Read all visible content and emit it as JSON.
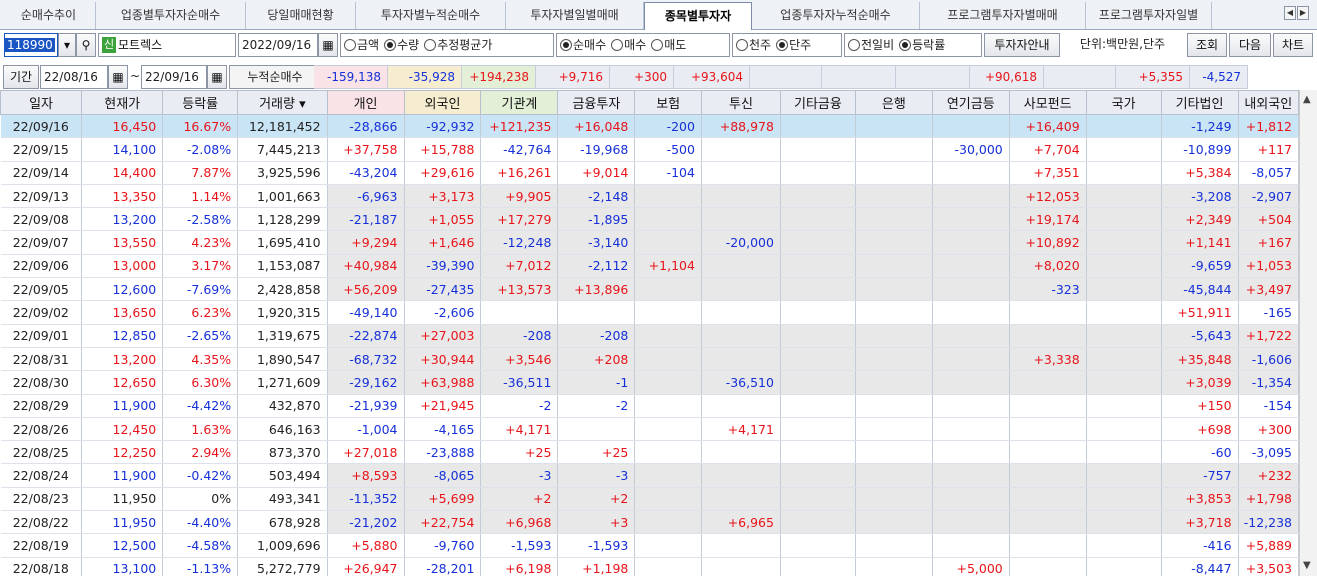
{
  "tabs": [
    {
      "label": "순매수추이"
    },
    {
      "label": "업종별투자자순매수"
    },
    {
      "label": "당일매매현황"
    },
    {
      "label": "투자자별누적순매수"
    },
    {
      "label": "투자자별일별매매"
    },
    {
      "label": "종목별투자자"
    },
    {
      "label": "업종투자자누적순매수"
    },
    {
      "label": "프로그램투자자별매매"
    },
    {
      "label": "프로그램투자자일별"
    }
  ],
  "active_tab": "종목별투자자",
  "toolbar": {
    "code": "118990",
    "name_badge": "신",
    "name": "모트렉스",
    "date": "2022/09/16",
    "group1": [
      "금액",
      "수량",
      "추정평균가"
    ],
    "group1_selected": "수량",
    "group2": [
      "순매수",
      "매수",
      "매도"
    ],
    "group2_selected": "순매수",
    "group3": [
      "천주",
      "단주"
    ],
    "group3_selected": "단주",
    "group4": [
      "전일비",
      "등락률"
    ],
    "group4_selected": "등락률",
    "investor_info_btn": "투자자안내",
    "unit": "단위:백만원,단주",
    "query_btn": "조회",
    "next_btn": "다음",
    "chart_btn": "차트"
  },
  "period": {
    "label": "기간",
    "from": "22/08/16",
    "sep": "~",
    "to": "22/09/16",
    "cum_label": "누적순매수"
  },
  "summary": [
    "-159,138",
    "-35,928",
    "+194,238",
    "+9,716",
    "+300",
    "+93,604",
    "",
    "",
    "",
    "+90,618",
    "",
    "+5,355",
    "-4,527"
  ],
  "columns": [
    "일자",
    "현재가",
    "등락률",
    "거래량",
    "개인",
    "외국인",
    "기관계",
    "금융투자",
    "보험",
    "투신",
    "기타금융",
    "은행",
    "연기금등",
    "사모펀드",
    "국가",
    "기타법인",
    "내외국인"
  ],
  "rows": [
    [
      "22/09/16",
      "16,450",
      "16.67%",
      "12,181,452",
      "-28,866",
      "-92,932",
      "+121,235",
      "+16,048",
      "-200",
      "+88,978",
      "",
      "",
      "",
      "+16,409",
      "",
      "-1,249",
      "+1,812"
    ],
    [
      "22/09/15",
      "14,100",
      "-2.08%",
      "7,445,213",
      "+37,758",
      "+15,788",
      "-42,764",
      "-19,968",
      "-500",
      "",
      "",
      "",
      "-30,000",
      "+7,704",
      "",
      "-10,899",
      "+117"
    ],
    [
      "22/09/14",
      "14,400",
      "7.87%",
      "3,925,596",
      "-43,204",
      "+29,616",
      "+16,261",
      "+9,014",
      "-104",
      "",
      "",
      "",
      "",
      "+7,351",
      "",
      "+5,384",
      "-8,057"
    ],
    [
      "22/09/13",
      "13,350",
      "1.14%",
      "1,001,663",
      "-6,963",
      "+3,173",
      "+9,905",
      "-2,148",
      "",
      "",
      "",
      "",
      "",
      "+12,053",
      "",
      "-3,208",
      "-2,907"
    ],
    [
      "22/09/08",
      "13,200",
      "-2.58%",
      "1,128,299",
      "-21,187",
      "+1,055",
      "+17,279",
      "-1,895",
      "",
      "",
      "",
      "",
      "",
      "+19,174",
      "",
      "+2,349",
      "+504"
    ],
    [
      "22/09/07",
      "13,550",
      "4.23%",
      "1,695,410",
      "+9,294",
      "+1,646",
      "-12,248",
      "-3,140",
      "",
      "-20,000",
      "",
      "",
      "",
      "+10,892",
      "",
      "+1,141",
      "+167"
    ],
    [
      "22/09/06",
      "13,000",
      "3.17%",
      "1,153,087",
      "+40,984",
      "-39,390",
      "+7,012",
      "-2,112",
      "+1,104",
      "",
      "",
      "",
      "",
      "+8,020",
      "",
      "-9,659",
      "+1,053"
    ],
    [
      "22/09/05",
      "12,600",
      "-7.69%",
      "2,428,858",
      "+56,209",
      "-27,435",
      "+13,573",
      "+13,896",
      "",
      "",
      "",
      "",
      "",
      "-323",
      "",
      "-45,844",
      "+3,497"
    ],
    [
      "22/09/02",
      "13,650",
      "6.23%",
      "1,920,315",
      "-49,140",
      "-2,606",
      "",
      "",
      "",
      "",
      "",
      "",
      "",
      "",
      "",
      "+51,911",
      "-165"
    ],
    [
      "22/09/01",
      "12,850",
      "-2.65%",
      "1,319,675",
      "-22,874",
      "+27,003",
      "-208",
      "-208",
      "",
      "",
      "",
      "",
      "",
      "",
      "",
      "-5,643",
      "+1,722"
    ],
    [
      "22/08/31",
      "13,200",
      "4.35%",
      "1,890,547",
      "-68,732",
      "+30,944",
      "+3,546",
      "+208",
      "",
      "",
      "",
      "",
      "",
      "+3,338",
      "",
      "+35,848",
      "-1,606"
    ],
    [
      "22/08/30",
      "12,650",
      "6.30%",
      "1,271,609",
      "-29,162",
      "+63,988",
      "-36,511",
      "-1",
      "",
      "-36,510",
      "",
      "",
      "",
      "",
      "",
      "+3,039",
      "-1,354"
    ],
    [
      "22/08/29",
      "11,900",
      "-4.42%",
      "432,870",
      "-21,939",
      "+21,945",
      "-2",
      "-2",
      "",
      "",
      "",
      "",
      "",
      "",
      "",
      "+150",
      "-154"
    ],
    [
      "22/08/26",
      "12,450",
      "1.63%",
      "646,163",
      "-1,004",
      "-4,165",
      "+4,171",
      "",
      "",
      "+4,171",
      "",
      "",
      "",
      "",
      "",
      "+698",
      "+300"
    ],
    [
      "22/08/25",
      "12,250",
      "2.94%",
      "873,370",
      "+27,018",
      "-23,888",
      "+25",
      "+25",
      "",
      "",
      "",
      "",
      "",
      "",
      "",
      "-60",
      "-3,095"
    ],
    [
      "22/08/24",
      "11,900",
      "-0.42%",
      "503,494",
      "+8,593",
      "-8,065",
      "-3",
      "-3",
      "",
      "",
      "",
      "",
      "",
      "",
      "",
      "-757",
      "+232"
    ],
    [
      "22/08/23",
      "11,950",
      "0%",
      "493,341",
      "-11,352",
      "+5,699",
      "+2",
      "+2",
      "",
      "",
      "",
      "",
      "",
      "",
      "",
      "+3,853",
      "+1,798"
    ],
    [
      "22/08/22",
      "11,950",
      "-4.40%",
      "678,928",
      "-21,202",
      "+22,754",
      "+6,968",
      "+3",
      "",
      "+6,965",
      "",
      "",
      "",
      "",
      "",
      "+3,718",
      "-12,238"
    ],
    [
      "22/08/19",
      "12,500",
      "-4.58%",
      "1,009,696",
      "+5,880",
      "-9,760",
      "-1,593",
      "-1,593",
      "",
      "",
      "",
      "",
      "",
      "",
      "",
      "-416",
      "+5,889"
    ],
    [
      "22/08/18",
      "13,100",
      "-1.13%",
      "5,272,779",
      "+26,947",
      "-28,201",
      "+6,198",
      "+1,198",
      "",
      "",
      "",
      "",
      "+5,000",
      "",
      "",
      "-8,447",
      "+3,503"
    ]
  ],
  "colors": {
    "up": "#e8141a",
    "down": "#1530d8",
    "selected_row": "#c9e4f5",
    "shade_row": "#e8e8e8",
    "sum_individual": "#f9e3e6",
    "sum_foreign": "#f6edd0",
    "sum_inst": "#e3f0d7"
  }
}
